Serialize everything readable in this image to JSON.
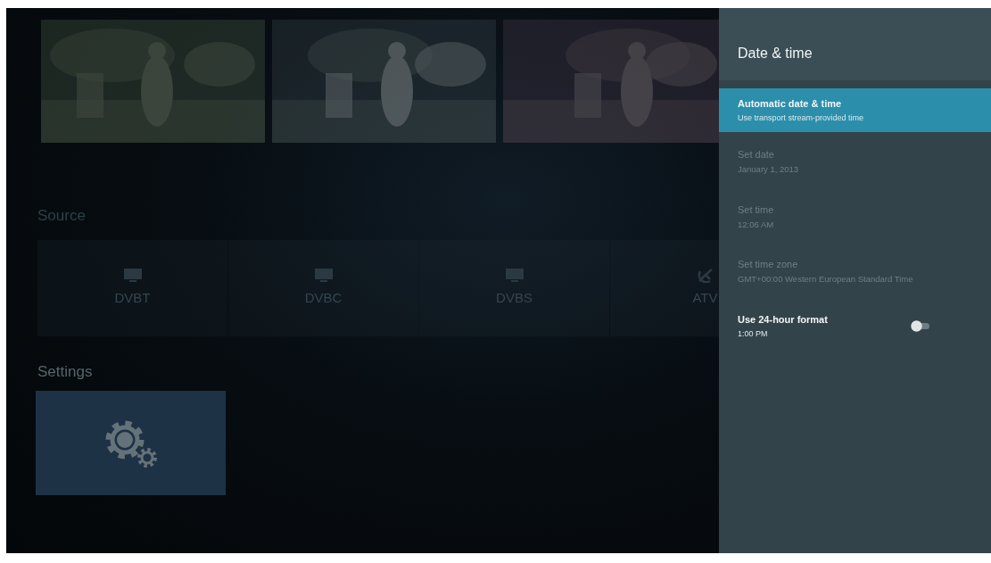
{
  "source": {
    "heading": "Source",
    "tiles": [
      {
        "label": "DVBT",
        "kind": "monitor"
      },
      {
        "label": "DVBC",
        "kind": "monitor"
      },
      {
        "label": "DVBS",
        "kind": "monitor"
      },
      {
        "label": "ATV",
        "kind": "antenna"
      }
    ]
  },
  "settings": {
    "heading": "Settings"
  },
  "panel": {
    "title": "Date & time",
    "items": [
      {
        "kind": "text",
        "title": "Automatic date & time",
        "summary": "Use transport stream-provided time",
        "selected": true,
        "disabled": false
      },
      {
        "kind": "text",
        "title": "Set date",
        "summary": "January 1, 2013",
        "selected": false,
        "disabled": true
      },
      {
        "kind": "text",
        "title": "Set time",
        "summary": "12:06 AM",
        "selected": false,
        "disabled": true
      },
      {
        "kind": "text",
        "title": "Set time zone",
        "summary": "GMT+00:00 Western European Standard Time",
        "selected": false,
        "disabled": true
      },
      {
        "kind": "switch",
        "title": "Use 24-hour format",
        "summary": "1:00 PM",
        "selected": false,
        "disabled": false,
        "on": false
      }
    ]
  }
}
